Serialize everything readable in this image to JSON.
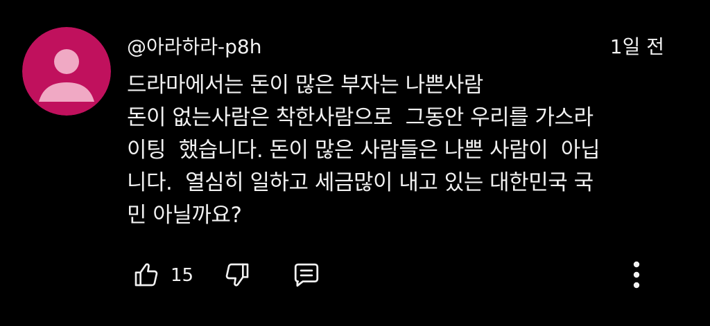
{
  "comment": {
    "author": "@아라하라-p8h",
    "timestamp": "1일 전",
    "avatar_color": "#c0115d",
    "body_lines": [
      "드라마에서는 돈이 많은 부자는 나쁜사람",
      "돈이 없는사람은 착한사람으로  그동안 우리를 가스라",
      "이팅  했습니다. 돈이 많은 사람들은 나쁜 사람이  아닙",
      "니다.  열심히 일하고 세금많이 내고 있는 대한민국 국",
      "민 아닐까요?"
    ],
    "actions": {
      "like_icon": "thumbs-up-icon",
      "like_count": "15",
      "dislike_icon": "thumbs-down-icon",
      "reply_icon": "comment-icon",
      "more_icon": "more-vertical-icon"
    }
  }
}
